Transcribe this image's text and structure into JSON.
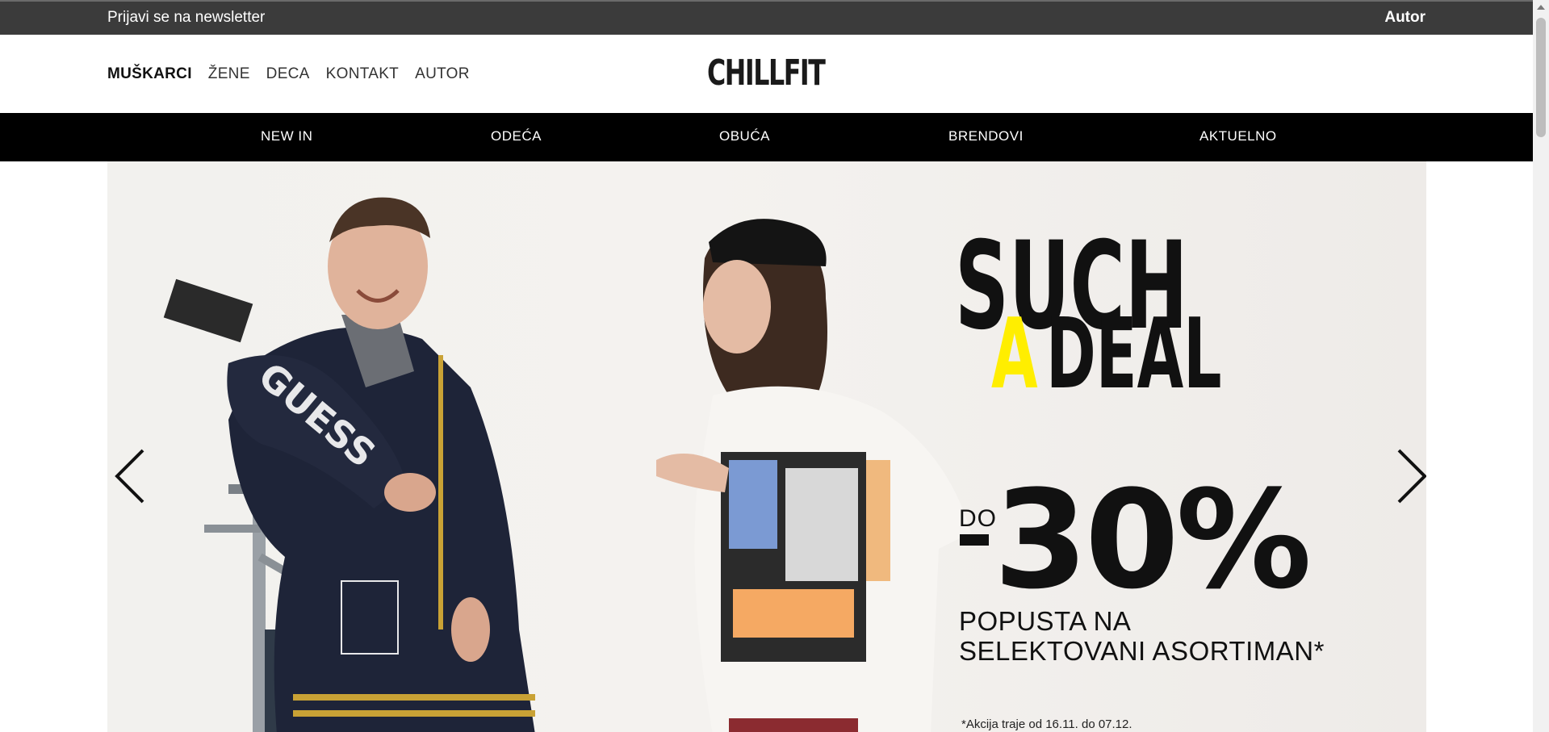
{
  "topbar": {
    "newsletter": "Prijavi se na newsletter",
    "autor": "Autor"
  },
  "header": {
    "logo": "CHILLFIT",
    "gender_nav": [
      "MUŠKARCI",
      "ŽENE",
      "DECA",
      "KONTAKT",
      "AUTOR"
    ],
    "active": "MUŠKARCI"
  },
  "main_nav": [
    "NEW IN",
    "ODEĆA",
    "OBUĆA",
    "BRENDOVI",
    "AKTUELNO"
  ],
  "hero": {
    "headline_line1": "SUCH",
    "headline_a": "A",
    "headline_line2": "DEAL",
    "do": "DO",
    "discount": "30%",
    "popusta_line1": "POPUSTA NA",
    "popusta_line2": "SELEKTOVANI ASORTIMAN*",
    "footnote": "*Akcija traje od 16.11. do 07.12.",
    "prev_icon": "chevron-left-icon",
    "next_icon": "chevron-right-icon"
  },
  "colors": {
    "topbar_bg": "#3b3b3b",
    "nav_bg": "#000000",
    "accent_yellow": "#ffee00"
  }
}
